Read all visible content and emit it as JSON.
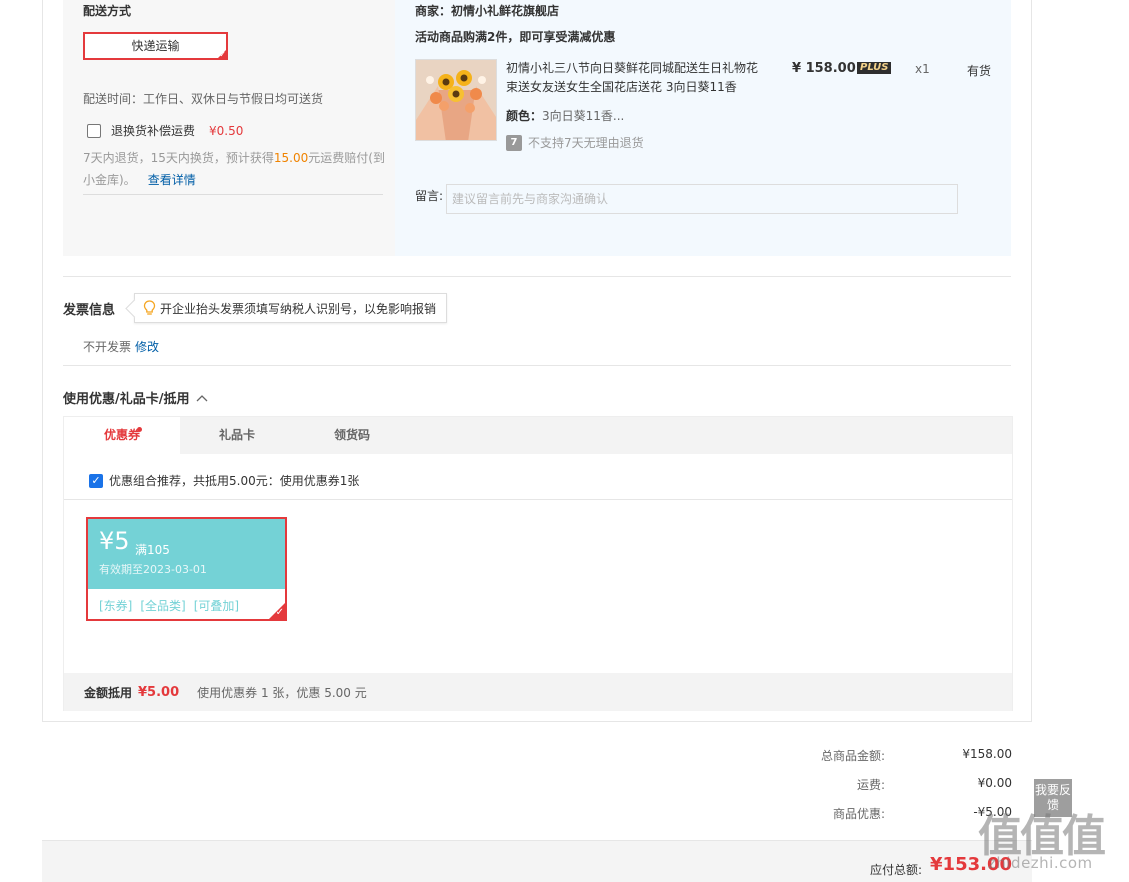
{
  "shipping": {
    "title": "配送方式",
    "method_label": "快递运输",
    "time_text": "配送时间：工作日、双休日与节假日均可送货",
    "return_insurance_label": "退换货补偿运费",
    "return_insurance_price": "¥0.50",
    "return_desc_pre": "7天内退货，15天内换货，预计获得",
    "return_desc_amount": "15.00",
    "return_desc_post": "元运费赔付(到小金库)。",
    "detail_link": "查看详情"
  },
  "order_item": {
    "shop": "商家：初情小礼鲜花旗舰店",
    "promo": "活动商品购满2件，即可享受满减优惠",
    "product_name": "初情小礼三八节向日葵鲜花同城配送生日礼物花束送女友送女生全国花店送花 3向日葵11香",
    "price": "¥ 158.00",
    "plus_badge": "PLUS",
    "qty": "x1",
    "stock": "有货",
    "color_label": "颜色：",
    "color_value": "3向日葵11香...",
    "no_return_icon": "7",
    "no_return_text": "不支持7天无理由退货",
    "message_label": "留言:",
    "message_placeholder": "建议留言前先与商家沟通确认"
  },
  "invoice": {
    "title": "发票信息",
    "tip": "开企业抬头发票须填写纳税人识别号，以免影响报销",
    "status": "不开发票",
    "modify_link": "修改"
  },
  "coupons": {
    "title": "使用优惠/礼品卡/抵用",
    "expand_icon": "chevron-up-icon",
    "tabs": [
      {
        "label": "优惠券"
      },
      {
        "label": "礼品卡"
      },
      {
        "label": "领货码"
      }
    ],
    "recommend_text": "优惠组合推荐，共抵用5.00元：使用优惠券1张",
    "card": {
      "amount": "¥5",
      "condition": "满105",
      "valid": "有效期至2023-03-01",
      "tags": [
        "[东券]",
        "[全品类]",
        "[可叠加]"
      ]
    },
    "deduct_label": "金额抵用",
    "deduct_amount": "¥5.00",
    "deduct_desc": "使用优惠券 1 张，优惠 5.00 元"
  },
  "summary": {
    "goods_total_label": "总商品金额:",
    "goods_total_value": "¥158.00",
    "freight_label": "运费:",
    "freight_value": "¥0.00",
    "discount_label": "商品优惠:",
    "discount_value": "-¥5.00",
    "payable_label": "应付总额:",
    "payable_value": "¥153.00"
  },
  "feedback": {
    "label": "我要反馈"
  },
  "watermark": {
    "big": "值值值",
    "small": "zhidezhi.com"
  },
  "colors": {
    "accent_red": "#e4393c",
    "coupon_teal": "#74d2d6",
    "link_blue": "#005ea7",
    "highlight_orange": "#f08300"
  }
}
